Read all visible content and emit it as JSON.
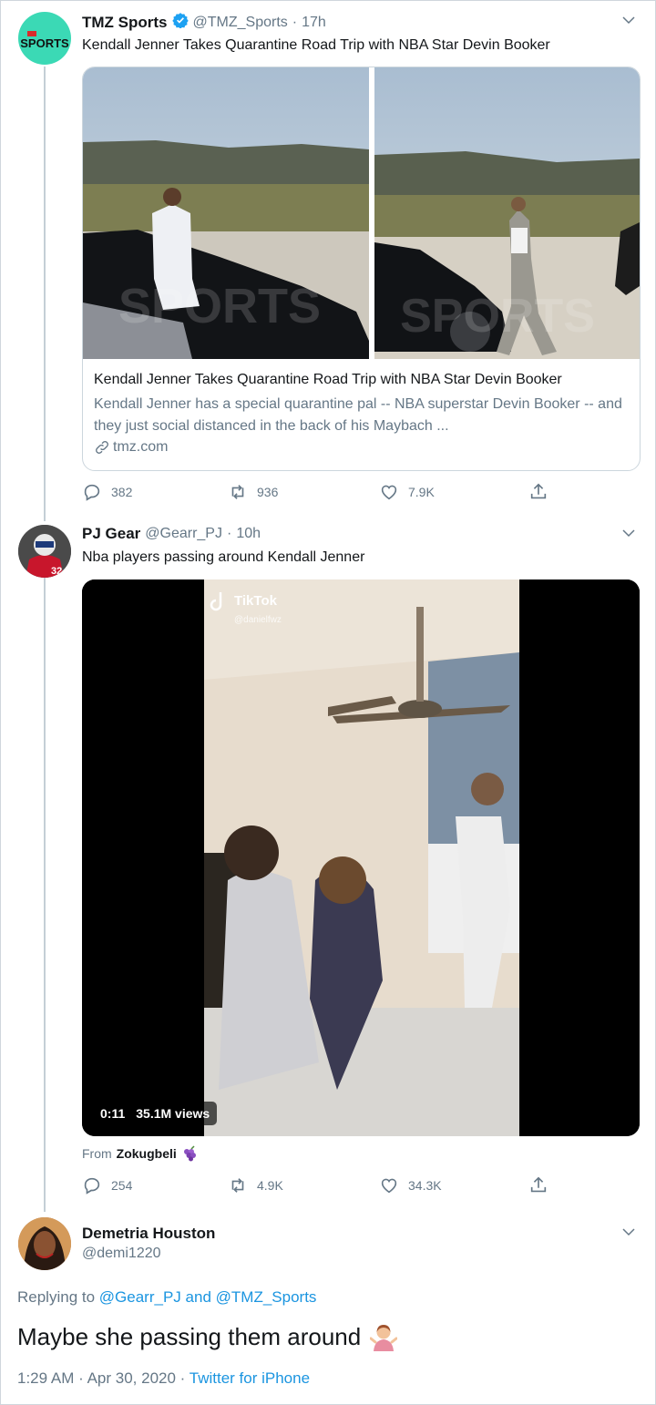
{
  "tweet1": {
    "display_name": "TMZ Sports",
    "handle": "@TMZ_Sports",
    "separator": "·",
    "time": "17h",
    "text": "Kendall Jenner Takes Quarantine Road Trip with NBA Star Devin Booker",
    "avatar_text": "SPORTS",
    "avatar_color": "#3bd9b5",
    "card": {
      "title": "Kendall Jenner Takes Quarantine Road Trip with NBA Star Devin Booker",
      "description": "Kendall Jenner has a special quarantine pal -- NBA superstar Devin Booker -- and they just social distanced in the back of his Maybach ...",
      "domain": "tmz.com",
      "watermark": "SPORTS"
    },
    "replies": "382",
    "retweets": "936",
    "likes": "7.9K"
  },
  "tweet2": {
    "display_name": "PJ Gear",
    "handle": "@Gearr_PJ",
    "separator": "·",
    "time": "10h",
    "text": "Nba players passing around Kendall Jenner",
    "video": {
      "brand": "TikTok",
      "creator": "@danielfwz",
      "duration": "0:11",
      "views": "35.1M views"
    },
    "from_label": "From",
    "from_user": "Zokugbeli",
    "replies": "254",
    "retweets": "4.9K",
    "likes": "34.3K"
  },
  "tweet3": {
    "display_name": "Demetria Houston",
    "handle": "@demi1220",
    "replying_label": "Replying to",
    "reply_to_1": "@Gearr_PJ",
    "reply_and": "and",
    "reply_to_2": "@TMZ_Sports",
    "text": "Maybe she passing them around",
    "time": "1:29 AM",
    "date": "Apr 30, 2020",
    "separator": "·",
    "source": "Twitter for iPhone"
  },
  "colors": {
    "link": "#1b95e0",
    "muted": "#657786",
    "verified": "#1da1f2",
    "thread_line": "#c4cfd6"
  }
}
